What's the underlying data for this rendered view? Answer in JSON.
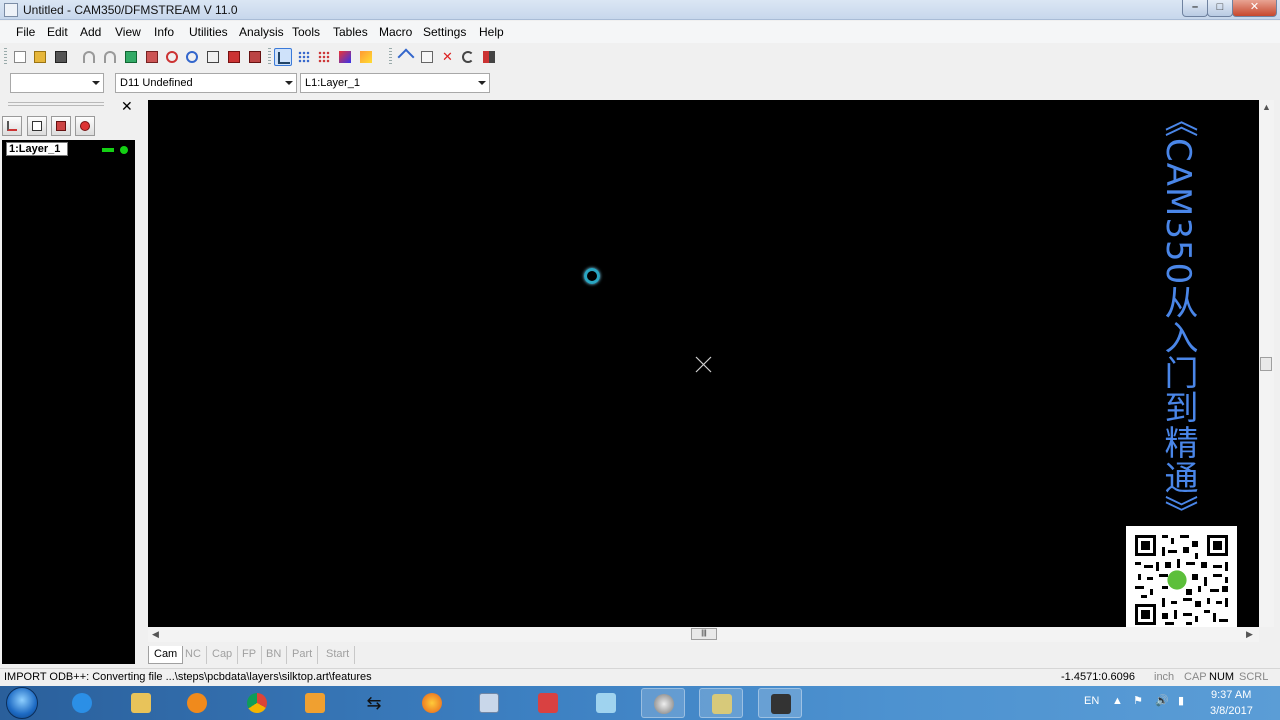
{
  "window": {
    "title": "Untitled - CAM350/DFMSTREAM V 11.0"
  },
  "menu": {
    "file": "File",
    "edit": "Edit",
    "add": "Add",
    "view": "View",
    "info": "Info",
    "utilities": "Utilities",
    "analysis": "Analysis",
    "tools": "Tools",
    "tables": "Tables",
    "macro": "Macro",
    "settings": "Settings",
    "help": "Help"
  },
  "combos": {
    "blank_value": "",
    "dcode_value": "D11  Undefined",
    "layer_value": "L1:Layer_1"
  },
  "layers_panel": {
    "layer_name": "1:Layer_1"
  },
  "canvas": {
    "watermark": "《CAM350从入门到精通》"
  },
  "tabs": {
    "cam": "Cam",
    "nc": "NC",
    "cap": "Cap",
    "fp": "FP",
    "bn": "BN",
    "part": "Part",
    "start": "Start"
  },
  "status": {
    "message": "IMPORT ODB++: Converting file ...\\steps\\pcbdata\\layers\\silktop.art\\features",
    "coords": "-1.4571:0.6096",
    "units": "inch",
    "cap": "CAP",
    "num": "NUM",
    "scrl": "SCRL"
  },
  "taskbar": {
    "lang": "EN",
    "time": "9:37 AM",
    "date": "3/8/2017"
  },
  "colors": {
    "canvas_bg": "#000000",
    "layer_green": "#14d014",
    "watermark_blue": "#4a86e8",
    "taskbar_blue": "#3c7fc1"
  }
}
